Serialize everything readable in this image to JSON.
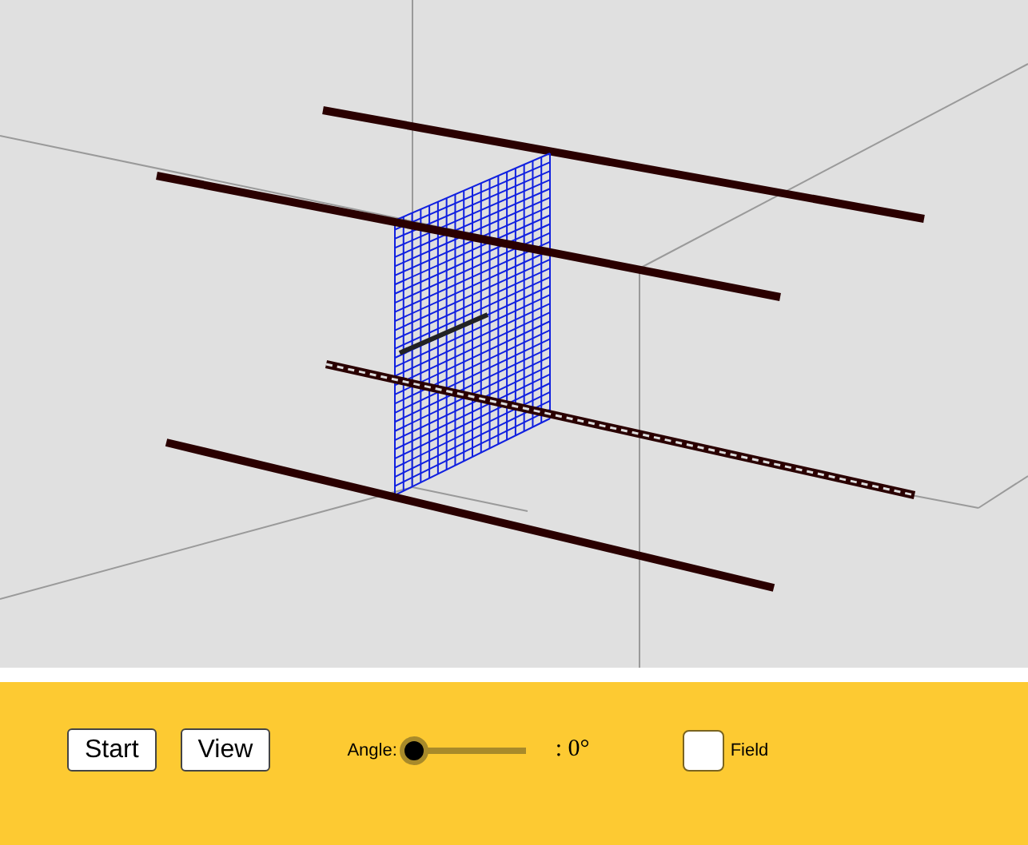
{
  "buttons": [
    {
      "label": "Start"
    },
    {
      "label": "View"
    }
  ],
  "slider": {
    "label": "Angle:",
    "level": 0,
    "reading": ": 0°"
  },
  "checkbox": {
    "label": "Field",
    "checked": false
  }
}
